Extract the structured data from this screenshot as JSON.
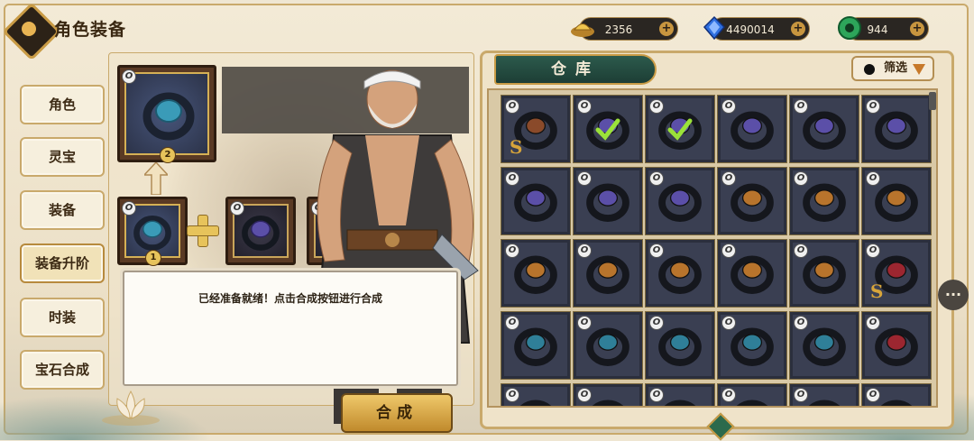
{
  "header": {
    "title": "角色装备",
    "currencies": [
      {
        "name": "gold-ingot",
        "value": "2356"
      },
      {
        "name": "blue-gem",
        "value": "4490014"
      },
      {
        "name": "jade",
        "value": "944"
      }
    ],
    "plus_label": "+"
  },
  "tabs": [
    {
      "label": "角色",
      "active": false
    },
    {
      "label": "灵宝",
      "active": false
    },
    {
      "label": "装备",
      "active": false
    },
    {
      "label": "装备升阶",
      "active": true
    },
    {
      "label": "时装",
      "active": false
    },
    {
      "label": "宝石合成",
      "active": false
    }
  ],
  "upgrade": {
    "result_level": "2",
    "base_level": "1",
    "message": "已经准备就绪！点击合成按钮进行合成",
    "combine_label": "合成"
  },
  "warehouse": {
    "title": "仓库",
    "filter_label": "筛选",
    "rows": [
      [
        {
          "ring": "bronze",
          "s": true,
          "check": false
        },
        {
          "ring": "purple",
          "s": false,
          "check": true
        },
        {
          "ring": "purple",
          "s": false,
          "check": true
        },
        {
          "ring": "purple",
          "s": false,
          "check": false
        },
        {
          "ring": "purple",
          "s": false,
          "check": false
        },
        {
          "ring": "purple",
          "s": false,
          "check": false
        }
      ],
      [
        {
          "ring": "purple",
          "s": false,
          "check": false
        },
        {
          "ring": "purple",
          "s": false,
          "check": false
        },
        {
          "ring": "purple",
          "s": false,
          "check": false
        },
        {
          "ring": "orange",
          "s": false,
          "check": false
        },
        {
          "ring": "orange",
          "s": false,
          "check": false
        },
        {
          "ring": "orange",
          "s": false,
          "check": false
        }
      ],
      [
        {
          "ring": "orange",
          "s": false,
          "check": false
        },
        {
          "ring": "orange",
          "s": false,
          "check": false
        },
        {
          "ring": "orange",
          "s": false,
          "check": false
        },
        {
          "ring": "orange",
          "s": false,
          "check": false
        },
        {
          "ring": "orange",
          "s": false,
          "check": false
        },
        {
          "ring": "red",
          "s": true,
          "check": false
        }
      ],
      [
        {
          "ring": "teal",
          "s": false,
          "check": false
        },
        {
          "ring": "teal",
          "s": false,
          "check": false
        },
        {
          "ring": "teal",
          "s": false,
          "check": false
        },
        {
          "ring": "teal",
          "s": false,
          "check": false
        },
        {
          "ring": "teal",
          "s": false,
          "check": false
        },
        {
          "ring": "red",
          "s": false,
          "check": false
        }
      ],
      [
        {
          "ring": "red",
          "s": false,
          "check": false
        },
        {
          "ring": "red",
          "s": false,
          "check": false
        },
        {
          "ring": "red",
          "s": false,
          "check": false
        },
        {
          "ring": "teal",
          "s": false,
          "check": false
        },
        {
          "ring": "grey",
          "s": false,
          "check": false
        },
        {
          "ring": "teal",
          "s": false,
          "check": false
        }
      ]
    ],
    "s_label": "S"
  },
  "ring_colors": {
    "bronze": "#8a4a2a",
    "purple": "#5b4fa8",
    "orange": "#b8742c",
    "red": "#9c2630",
    "teal": "#2f7f98",
    "grey": "#6a6f7a"
  },
  "chat_label": "···"
}
